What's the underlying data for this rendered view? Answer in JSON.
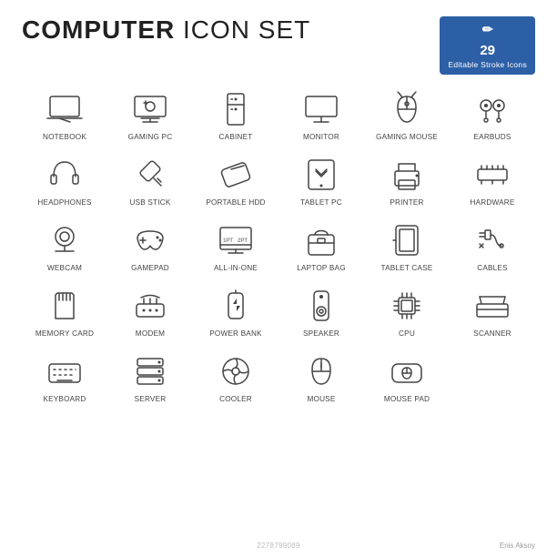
{
  "header": {
    "title_part1": "COMPUTER",
    "title_part2": " ICON SET",
    "badge": {
      "num": "29",
      "line1": "Editable Stroke Icons"
    }
  },
  "icons": [
    {
      "id": "notebook",
      "label": "NOTEBOOK"
    },
    {
      "id": "gaming-pc",
      "label": "GAMING PC"
    },
    {
      "id": "cabinet",
      "label": "CABINET"
    },
    {
      "id": "monitor",
      "label": "MONITOR"
    },
    {
      "id": "gaming-mouse",
      "label": "GAMING MOUSE"
    },
    {
      "id": "earbuds",
      "label": "EARBUDS"
    },
    {
      "id": "headphones",
      "label": "HEADPHONES"
    },
    {
      "id": "usb-stick",
      "label": "USB STICK"
    },
    {
      "id": "portable-hdd",
      "label": "PORTABLE HDD"
    },
    {
      "id": "tablet-pc",
      "label": "TABLET PC"
    },
    {
      "id": "printer",
      "label": "PRINTER"
    },
    {
      "id": "hardware",
      "label": "HARDWARE"
    },
    {
      "id": "webcam",
      "label": "WEBCAM"
    },
    {
      "id": "gamepad",
      "label": "GAMEPAD"
    },
    {
      "id": "all-in-one",
      "label": "ALL-IN-ONE"
    },
    {
      "id": "laptop-bag",
      "label": "LAPTOP BAG"
    },
    {
      "id": "tablet-case",
      "label": "TABLET CASE"
    },
    {
      "id": "cables",
      "label": "CABLES"
    },
    {
      "id": "memory-card",
      "label": "MEMORY CARD"
    },
    {
      "id": "modem",
      "label": "MODEM"
    },
    {
      "id": "power-bank",
      "label": "POWER BANK"
    },
    {
      "id": "speaker",
      "label": "SPEAKER"
    },
    {
      "id": "cpu",
      "label": "CPU"
    },
    {
      "id": "scanner",
      "label": "SCANNER"
    },
    {
      "id": "keyboard",
      "label": "KEYBOARD"
    },
    {
      "id": "server",
      "label": "SERVER"
    },
    {
      "id": "cooler",
      "label": "COOLER"
    },
    {
      "id": "mouse",
      "label": "MOUSE"
    },
    {
      "id": "mouse-pad",
      "label": "MOUSE PAD"
    }
  ],
  "watermark": "2278799089",
  "author": "Enis Aksoy"
}
